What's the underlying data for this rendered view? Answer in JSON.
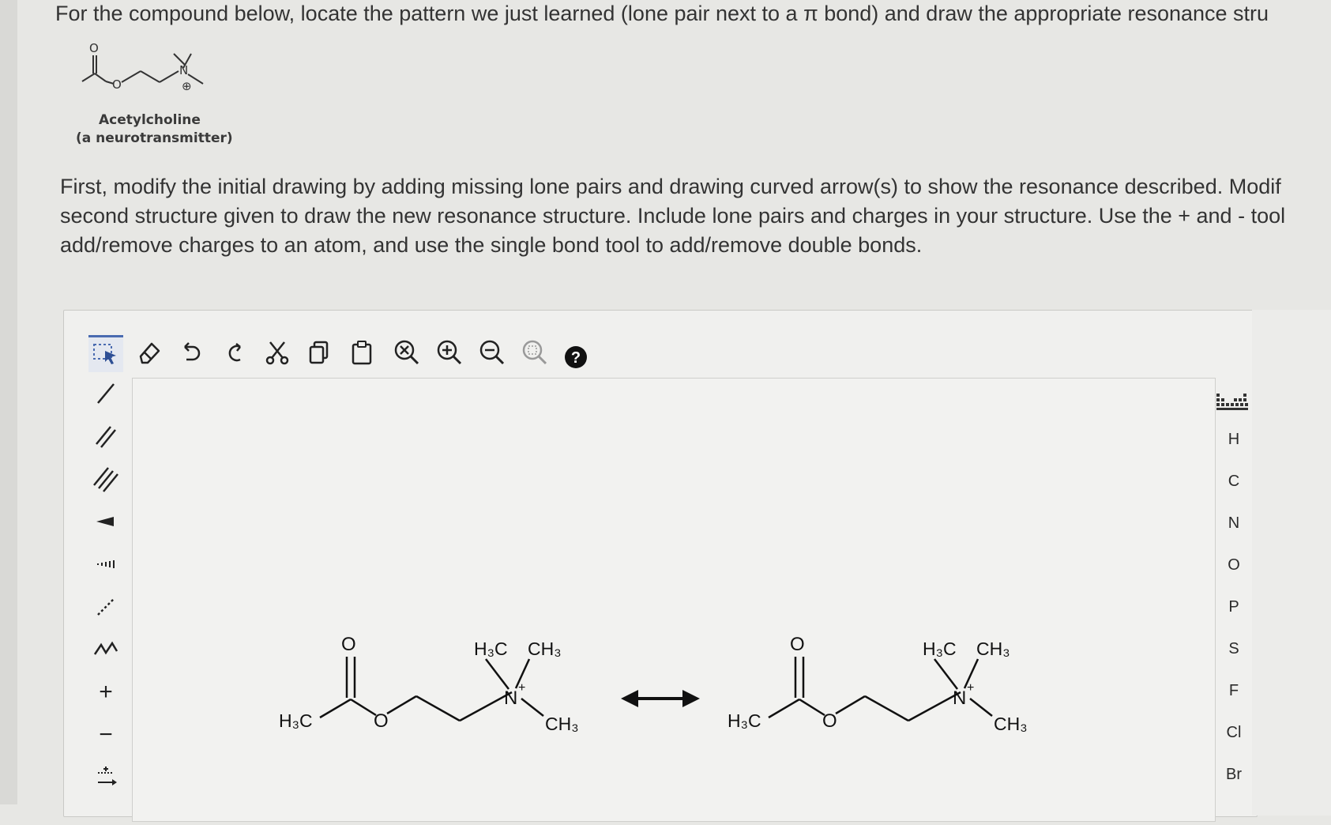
{
  "question": {
    "text": "For the compound below, locate the pattern we just learned (lone pair next to a π bond) and draw the appropriate resonance stru"
  },
  "intro_structure": {
    "caption_name": "Acetylcholine",
    "caption_sub": "(a neurotransmitter)",
    "atoms": {
      "o_dbl": "O",
      "o_ester": "O",
      "n": "N",
      "charge": "⊕"
    }
  },
  "instructions": {
    "line1": "First, modify the initial drawing by adding missing lone pairs and drawing curved arrow(s) to show the resonance described. Modif",
    "line2": "second structure given to draw the new resonance structure. Include lone pairs and charges in your structure. Use the + and - tool",
    "line3": "add/remove charges to an atom, and use the single bond tool to add/remove double bonds."
  },
  "toolbar": {
    "icons": [
      "select-icon",
      "eraser-icon",
      "undo-icon",
      "redo-icon",
      "cut-icon",
      "copy-icon",
      "paste-icon",
      "clear-icon",
      "zoom-in-icon",
      "zoom-out-icon",
      "zoom-fit-icon",
      "help-icon"
    ],
    "help_glyph": "?"
  },
  "left_tools": {
    "plus": "+",
    "minus": "−"
  },
  "atoms_panel": [
    "H",
    "C",
    "N",
    "O",
    "P",
    "S",
    "F",
    "Cl",
    "Br"
  ],
  "structure_left": {
    "h3c": "H₃C",
    "o_dbl": "O",
    "o_ester": "O",
    "n": "N",
    "n_charge": "+",
    "ch3_a": "H₃C",
    "ch3_b": "CH₃",
    "ch3_c": "CH₃"
  },
  "structure_right": {
    "h3c": "H₃C",
    "o_dbl": "O",
    "o_ester": "O",
    "n": "N",
    "n_charge": "+",
    "ch3_a": "H₃C",
    "ch3_b": "CH₃",
    "ch3_c": "CH₃"
  }
}
